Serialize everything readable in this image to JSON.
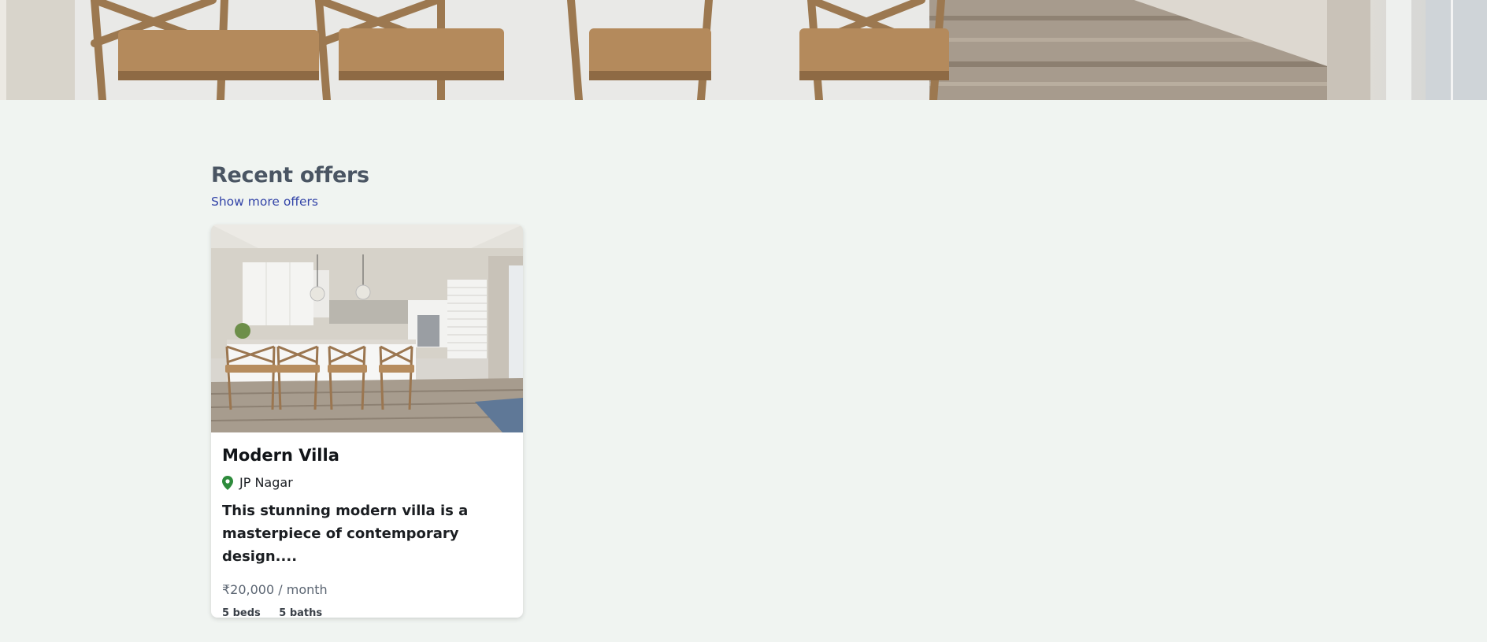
{
  "hero": {
    "image": "kitchen-interior-photo"
  },
  "section": {
    "title": "Recent offers",
    "more_link": "Show more offers"
  },
  "offers": [
    {
      "title": "Modern Villa",
      "location_icon": "map-pin-icon",
      "location": "JP Nagar",
      "description": "This stunning modern villa is a masterpiece of contemporary design....",
      "price": "₹20,000 / month",
      "beds": "5 beds",
      "baths": "5 baths",
      "image": "kitchen-interior-photo"
    }
  ],
  "colors": {
    "page_background": "#f0f4f1",
    "heading": "#4a5563",
    "link": "#3344a8",
    "pin": "#2e8b3c",
    "price": "#5b6572"
  }
}
